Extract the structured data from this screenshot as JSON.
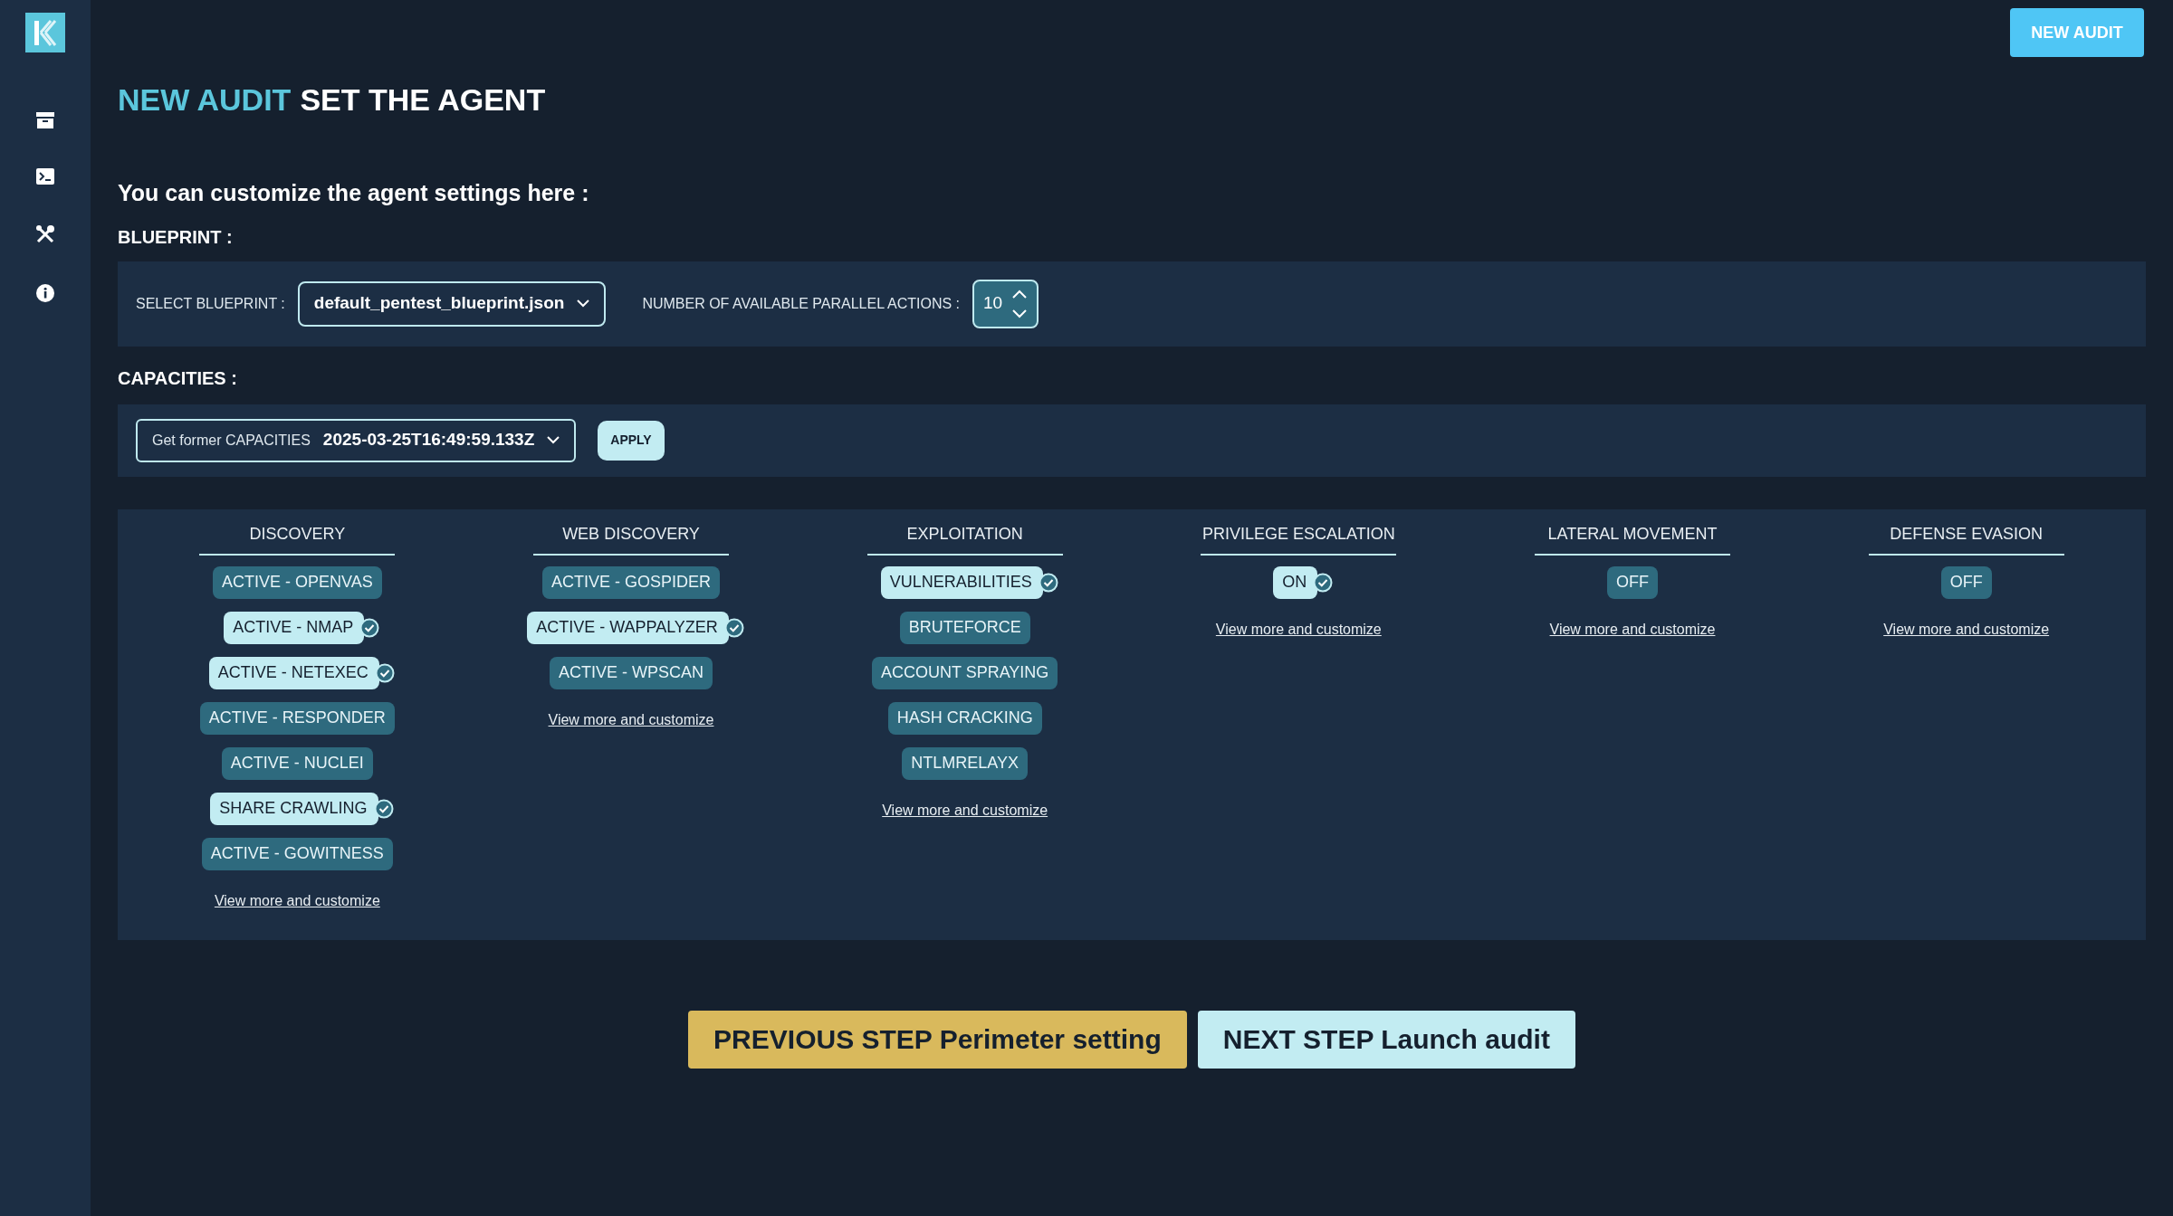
{
  "header_button": "NEW AUDIT",
  "title": {
    "accent": "NEW AUDIT",
    "text": "SET THE AGENT"
  },
  "intro": "You can customize the agent settings here :",
  "blueprint": {
    "heading": "BLUEPRINT :",
    "select_label": "SELECT BLUEPRINT :",
    "select_value": "default_pentest_blueprint.json",
    "parallel_label": "NUMBER OF AVAILABLE PARALLEL ACTIONS :",
    "parallel_value": "10"
  },
  "capacities": {
    "heading": "CAPACITIES :",
    "former_label": "Get former CAPACITIES",
    "former_value": "2025-03-25T16:49:59.133Z",
    "apply": "APPLY"
  },
  "categories": [
    {
      "title": "DISCOVERY",
      "items": [
        {
          "label": "ACTIVE - OPENVAS",
          "selected": false
        },
        {
          "label": "ACTIVE - NMAP",
          "selected": true
        },
        {
          "label": "ACTIVE - NETEXEC",
          "selected": true
        },
        {
          "label": "ACTIVE - RESPONDER",
          "selected": false
        },
        {
          "label": "ACTIVE - NUCLEI",
          "selected": false
        },
        {
          "label": "SHARE CRAWLING",
          "selected": true
        },
        {
          "label": "ACTIVE - GOWITNESS",
          "selected": false
        }
      ],
      "link": "View more and customize"
    },
    {
      "title": "WEB DISCOVERY",
      "items": [
        {
          "label": "ACTIVE - GOSPIDER",
          "selected": false
        },
        {
          "label": "ACTIVE - WAPPALYZER",
          "selected": true
        },
        {
          "label": "ACTIVE - WPSCAN",
          "selected": false
        }
      ],
      "link": "View more and customize"
    },
    {
      "title": "EXPLOITATION",
      "items": [
        {
          "label": "VULNERABILITIES",
          "selected": true
        },
        {
          "label": "BRUTEFORCE",
          "selected": false
        },
        {
          "label": "ACCOUNT SPRAYING",
          "selected": false
        },
        {
          "label": "HASH CRACKING",
          "selected": false
        },
        {
          "label": "NTLMRELAYX",
          "selected": false
        }
      ],
      "link": "View more and customize"
    },
    {
      "title": "PRIVILEGE ESCALATION",
      "items": [
        {
          "label": "ON",
          "selected": true
        }
      ],
      "link": "View more and customize"
    },
    {
      "title": "LATERAL MOVEMENT",
      "items": [
        {
          "label": "OFF",
          "selected": false
        }
      ],
      "link": "View more and customize"
    },
    {
      "title": "DEFENSE EVASION",
      "items": [
        {
          "label": "OFF",
          "selected": false
        }
      ],
      "link": "View more and customize"
    }
  ],
  "previous_button": "PREVIOUS STEP Perimeter setting",
  "next_button": "NEXT STEP Launch audit"
}
